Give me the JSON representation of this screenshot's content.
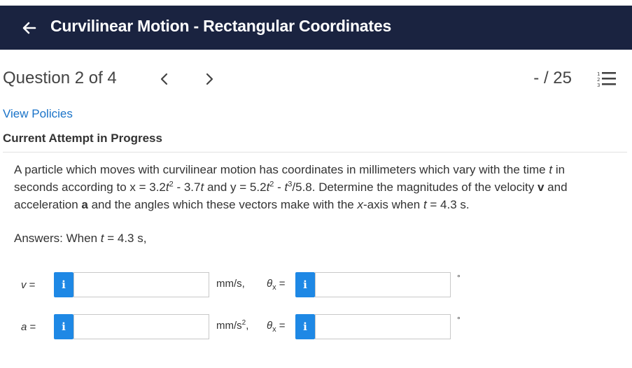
{
  "header": {
    "title": "Curvilinear Motion - Rectangular Coordinates",
    "bg_color": "#1a2340"
  },
  "question_nav": {
    "position_text": "Question 2 of 4",
    "score_text": "- / 25"
  },
  "links": {
    "view_policies": "View Policies"
  },
  "attempt": {
    "heading": "Current Attempt in Progress"
  },
  "problem": {
    "p1": "A particle which moves with curvilinear motion has coordinates in millimeters which vary with the time ",
    "t1": "t",
    "p2": " in seconds according to x = 3.2",
    "t2": "t",
    "sup2a": "2",
    "p3": " - 3.7",
    "t3": "t",
    "p4": " and y = 5.2",
    "t4": "t",
    "sup2b": "2",
    "p5": " - ",
    "t5": "t",
    "sup3": "3",
    "p6": "/5.8. Determine the magnitudes of the velocity ",
    "v_bold": "v",
    "p7": " and acceleration ",
    "a_bold": "a",
    "p8": " and the angles which these vectors make with the ",
    "x_ital": "x",
    "p9": "-axis when ",
    "t6": "t",
    "p10": " = 4.3 s."
  },
  "answers": {
    "label_prefix": "Answers: When ",
    "label_t": "t",
    "label_suffix": " = 4.3 s,",
    "rows": [
      {
        "var_symbol": "v",
        "var_eq": " =",
        "value": "",
        "unit": "mm/s,",
        "unit_sup": "",
        "theta_symbol": "θ",
        "theta_sub": "x",
        "theta_eq": " =",
        "angle_value": "",
        "degree": "°"
      },
      {
        "var_symbol": "a",
        "var_eq": " =",
        "value": "",
        "unit": "mm/s",
        "unit_sup": "2",
        "unit_after": ",",
        "theta_symbol": "θ",
        "theta_sub": "x",
        "theta_eq": " =",
        "angle_value": "",
        "degree": "°"
      }
    ],
    "info_glyph": "i",
    "info_color": "#1e88e5"
  },
  "icons": {
    "back": "arrow-left-icon",
    "prev": "chevron-left-icon",
    "next": "chevron-right-icon",
    "list": "numbered-list-icon",
    "info": "info-icon"
  }
}
